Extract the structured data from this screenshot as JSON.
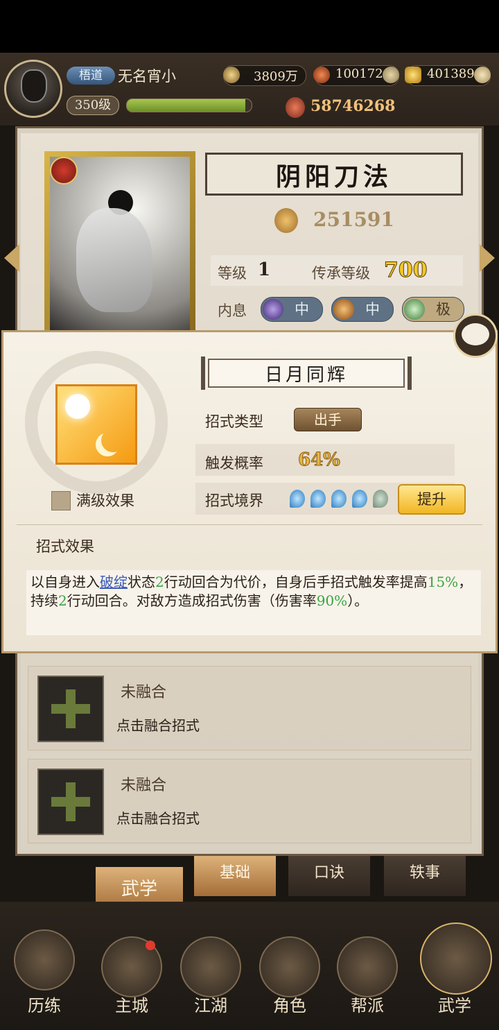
{
  "header": {
    "player_tag": "梧道",
    "player_name": "无名宵小",
    "level": "350级",
    "exp_fraction": 0.95,
    "coins": "3809万",
    "resource2": "100172",
    "gold": "401389",
    "power": "58746268"
  },
  "skill_card": {
    "name": "阴阳刀法",
    "power": "251591",
    "level_label": "等级",
    "level_value": "1",
    "inherit_label": "传承等级",
    "inherit_value": "700",
    "neixi_label": "内息",
    "neixi": [
      "中",
      "中",
      "极"
    ]
  },
  "popup": {
    "skill_name": "日月同辉",
    "max_level_label": "满级效果",
    "type_label": "招式类型",
    "type_value": "出手",
    "prob_label": "触发概率",
    "prob_value": "64%",
    "realm_label": "招式境界",
    "realm_level": 4,
    "realm_max": 5,
    "upgrade_label": "提升",
    "effect_heading": "招式效果",
    "effect_parts": {
      "p1": "以自身进入",
      "kw": "破绽",
      "p2": "状态",
      "n1": "2",
      "p3": "行动回合为代价，自身后手招式触发率提高",
      "n2": "15%",
      "p4": "，持续",
      "n3": "2",
      "p5": "行动回合。对敌方造成招式伤害（伤害率",
      "n4": "90%",
      "p6": "）。"
    }
  },
  "merge_slots": [
    {
      "title": "未融合",
      "subtitle": "点击融合招式"
    },
    {
      "title": "未融合",
      "subtitle": "点击融合招式"
    }
  ],
  "tabs": {
    "left": "武学",
    "basic": "基础",
    "mouth": "口诀",
    "anecdote": "轶事"
  },
  "bottom_nav": [
    "历练",
    "主城",
    "江湖",
    "角色",
    "帮派",
    "武学"
  ]
}
